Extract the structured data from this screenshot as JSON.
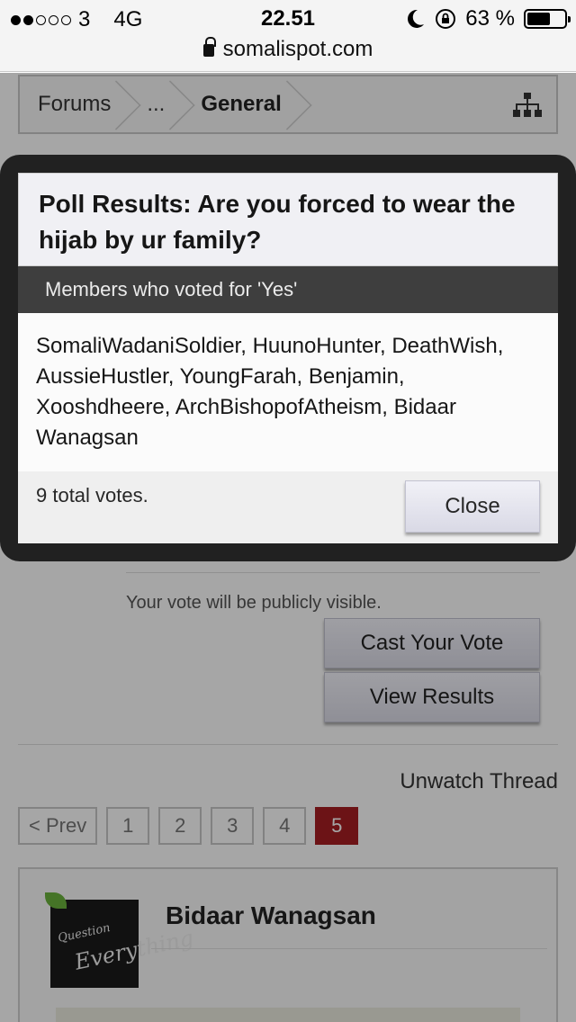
{
  "status_bar": {
    "carrier": "3",
    "network": "4G",
    "time": "22.51",
    "battery": "63 %",
    "battery_level": 0.63,
    "signal_bars_filled": 2,
    "signal_bars_total": 5
  },
  "url_bar": {
    "domain": "somalispot.com"
  },
  "breadcrumb": {
    "items": [
      "Forums",
      "...",
      "General"
    ]
  },
  "poll": {
    "hint": "Your vote will be publicly visible.",
    "cast_vote_label": "Cast Your Vote",
    "view_results_label": "View Results"
  },
  "thread": {
    "unwatch_label": "Unwatch Thread"
  },
  "pagination": {
    "prev_label": "< Prev",
    "pages": [
      "1",
      "2",
      "3",
      "4",
      "5"
    ],
    "current": "5"
  },
  "post": {
    "author": "Bidaar Wanagsan",
    "avatar_text_small": "Question",
    "avatar_text_large": "Everything"
  },
  "modal": {
    "title": "Poll Results: Are you forced to wear the hijab by ur family?",
    "subtitle": "Members who voted for 'Yes'",
    "voters": "SomaliWadaniSoldier, HuunoHunter, DeathWish, AussieHustler, YoungFarah, Benjamin, Xooshdheere, ArchBishopofAtheism, Bidaar Wanagsan",
    "total_votes": "9 total votes.",
    "close_label": "Close"
  },
  "colors": {
    "active_page": "#a71e22",
    "modal_frame": "#1c1c1c",
    "modal_subheader": "#3a3a3a",
    "avatar_leaf": "#6bb33c"
  }
}
